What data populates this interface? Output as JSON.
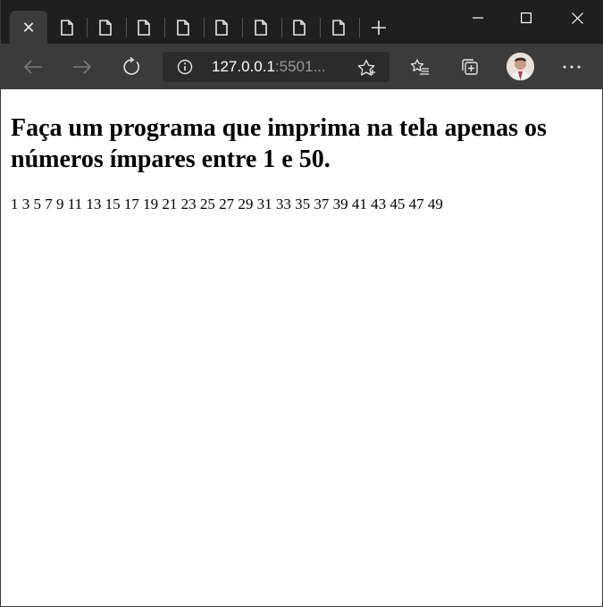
{
  "browser": {
    "tab_count_inactive": 8,
    "active_tab_close_glyph": "✕",
    "new_tab_glyph": "+",
    "window_controls": {
      "minimize_icon": "minimize-icon",
      "maximize_icon": "maximize-icon",
      "close_icon": "close-icon"
    },
    "address_bar": {
      "host": "127.0.0.1",
      "rest": ":5501..."
    },
    "colors": {
      "tabstrip": "#1f1f1f",
      "toolbar": "#3b3b3b",
      "address_bg": "#2b2b2b"
    }
  },
  "page": {
    "heading": "Faça um programa que imprima na tela apenas os números ímpares entre 1 e 50.",
    "numbers": "1 3 5 7 9 11 13 15 17 19 21 23 25 27 29 31 33 35 37 39 41 43 45 47 49"
  }
}
